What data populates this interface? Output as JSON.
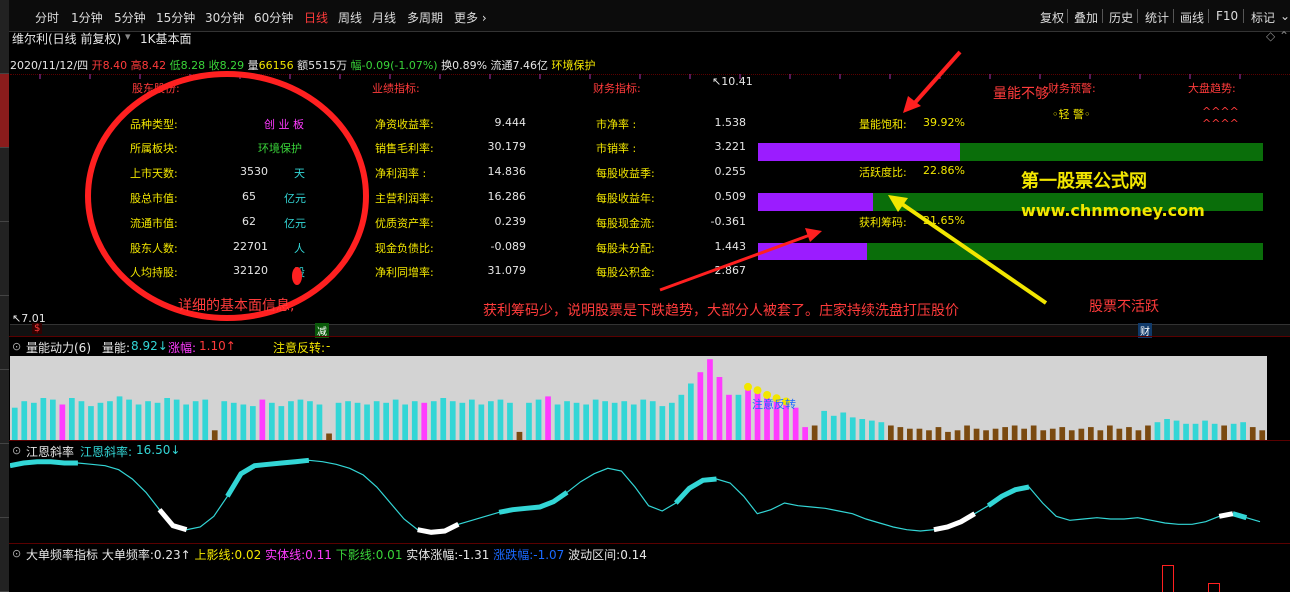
{
  "toolbar": {
    "periods": [
      "分时",
      "1分钟",
      "5分钟",
      "15分钟",
      "30分钟",
      "60分钟",
      "日线",
      "周线",
      "月线",
      "多周期",
      "更多 ›"
    ],
    "active_period": "日线",
    "tools": [
      "复权",
      "叠加",
      "历史",
      "统计",
      "画线",
      "F10",
      "标记"
    ]
  },
  "header": {
    "title": "维尔利(日线 前复权)",
    "template": "1K基本面"
  },
  "quote": {
    "date": "2020/11/12/四",
    "open_label": "开",
    "open": "8.40",
    "high_label": "高",
    "high": "8.42",
    "low_label": "低",
    "low": "8.28",
    "close_label": "收",
    "close": "8.29",
    "volume_label": "量",
    "volume": "66156",
    "amount_label": "额",
    "amount": "5515万",
    "change_label": "幅",
    "change": "-0.09(-1.07%)",
    "turnover_label": "换",
    "turnover": "0.89%",
    "float_label": "流通",
    "float": "7.46亿",
    "concept": "环境保护"
  },
  "axis": {
    "price_high": "10.41",
    "price_low": "7.01"
  },
  "sections": {
    "shareholder": "股东股份:",
    "performance": "业绩指标:",
    "finance": "财务指标:",
    "warning": "财务预警:",
    "trend": "大盘趋势:"
  },
  "shareholder": [
    {
      "label": "品种类型:",
      "value": "创 业 板",
      "unit": ""
    },
    {
      "label": "所属板块:",
      "value": "环境保护",
      "unit": ""
    },
    {
      "label": "上市天数:",
      "value": "3530",
      "unit": "天"
    },
    {
      "label": "股总市值:",
      "value": "65",
      "unit": "亿元"
    },
    {
      "label": "流通市值:",
      "value": "62",
      "unit": "亿元"
    },
    {
      "label": "股东人数:",
      "value": "22701",
      "unit": "人"
    },
    {
      "label": "人均持股:",
      "value": "32120",
      "unit": "股"
    }
  ],
  "performance": [
    {
      "label": "净资收益率:",
      "value": "9.444"
    },
    {
      "label": "销售毛利率:",
      "value": "30.179"
    },
    {
      "label": "净利润率  :",
      "value": "14.836"
    },
    {
      "label": "主营利润率:",
      "value": "16.286"
    },
    {
      "label": "优质资产率:",
      "value": "0.239"
    },
    {
      "label": "现金负债比:",
      "value": "-0.089"
    },
    {
      "label": "净利同增率:",
      "value": "31.079"
    }
  ],
  "finance": [
    {
      "label": "市净率    :",
      "value": "1.538"
    },
    {
      "label": "市销率    :",
      "value": "3.221"
    },
    {
      "label": "每股收益季:",
      "value": "0.255"
    },
    {
      "label": "每股收益年:",
      "value": "0.509"
    },
    {
      "label": "每股现金流:",
      "value": "-0.361"
    },
    {
      "label": "每股未分配:",
      "value": "1.443"
    },
    {
      "label": "每股公积金:",
      "value": "2.867"
    }
  ],
  "gauges": [
    {
      "label": "量能饱和:",
      "value": "39.92%",
      "fraction": 0.3992
    },
    {
      "label": "活跃度比:",
      "value": "22.86%",
      "fraction": 0.2286
    },
    {
      "label": "获利筹码:",
      "value": "21.65%",
      "fraction": 0.2165
    }
  ],
  "warning_value": "◦轻 警◦",
  "trend_arrows": [
    "^^^^",
    "^^^^"
  ],
  "annotations": {
    "volume_insufficient": "量能不够",
    "site_name": "第一股票公式网",
    "site_url": "www.chnmoney.com",
    "fundamental_info": "详细的基本面信息,",
    "profit_chips_note": "获利筹码少，说明股票是下跌趋势，大部分人被套了。庄家持续洗盘打压股价",
    "inactive": "股票不活跃"
  },
  "time_marks": [
    "$",
    "减",
    "财"
  ],
  "colors": {
    "purple_bar": "#9b1cff",
    "green_bar": "#0a6e0a",
    "cyan": "#33d6d6",
    "magenta": "#ff3bff",
    "yellow": "#f2e600",
    "red": "#ff3b3b"
  },
  "ind1": {
    "name": "量能动力(6)",
    "field1_label": "量能:",
    "field1_value": "8.92↓",
    "field2_label": "涨幅:",
    "field2_value": "1.10↑",
    "field3_label": "注意反转:",
    "field3_value": "-",
    "marker_text": "注意反转"
  },
  "ind2": {
    "name": "江恩斜率",
    "field_label": "江恩斜率:",
    "field_value": "16.50↓"
  },
  "ind3": {
    "name": "大单频率指标",
    "f1_label": "大单频率:",
    "f1_value": "0.23↑",
    "f2_label": "上影线:",
    "f2_value": "0.02",
    "f3_label": "实体线:",
    "f3_value": "0.11",
    "f4_label": "下影线:",
    "f4_value": "0.01",
    "f5_label": "实体涨幅:",
    "f5_value": "-1.31",
    "f6_label": "涨跌幅:",
    "f6_value": "-1.07",
    "f7_label": "波动区间:",
    "f7_value": "0.14"
  },
  "chart_data": [
    {
      "type": "bar",
      "title": "量能动力(6)",
      "colors_per_bar": "cyan/magenta/brown",
      "values": [
        20,
        24,
        23,
        26,
        25,
        22,
        26,
        24,
        21,
        23,
        24,
        27,
        25,
        22,
        24,
        23,
        26,
        25,
        22,
        24,
        25,
        6,
        24,
        23,
        22,
        21,
        25,
        23,
        21,
        24,
        25,
        24,
        22,
        4,
        23,
        24,
        23,
        22,
        24,
        23,
        25,
        22,
        24,
        23,
        24,
        26,
        24,
        23,
        25,
        22,
        24,
        25,
        23,
        5,
        23,
        25,
        27,
        22,
        24,
        23,
        22,
        25,
        24,
        23,
        24,
        22,
        25,
        24,
        21,
        23,
        28,
        35,
        42,
        50,
        39,
        28,
        28,
        31,
        29,
        26,
        24,
        22,
        20,
        8,
        9,
        18,
        15,
        17,
        14,
        13,
        12,
        11,
        9,
        8,
        7,
        7,
        6,
        8,
        5,
        6,
        9,
        7,
        6,
        7,
        8,
        9,
        7,
        9,
        6,
        7,
        8,
        6,
        7,
        8,
        6,
        9,
        7,
        8,
        6,
        9,
        11,
        13,
        12,
        10,
        10,
        12,
        10,
        9,
        10,
        11,
        8,
        6
      ]
    },
    {
      "type": "line",
      "title": "江恩斜率",
      "values": [
        58,
        60,
        61,
        61,
        60,
        60,
        59,
        58,
        55,
        48,
        38,
        25,
        13,
        10,
        12,
        20,
        35,
        52,
        58,
        59,
        60,
        61,
        62,
        61,
        59,
        56,
        51,
        42,
        30,
        18,
        10,
        8,
        9,
        14,
        17,
        20,
        23,
        25,
        26,
        27,
        31,
        38,
        46,
        52,
        56,
        54,
        42,
        28,
        24,
        30,
        41,
        47,
        48,
        45,
        35,
        22,
        25,
        30,
        28,
        27,
        26,
        24,
        22,
        18,
        15,
        12,
        10,
        9,
        10,
        12,
        16,
        22,
        28,
        35,
        40,
        42,
        30,
        20,
        17,
        18,
        19,
        18,
        18,
        19,
        17,
        15,
        14,
        14,
        16,
        20,
        22,
        19,
        16
      ]
    }
  ]
}
